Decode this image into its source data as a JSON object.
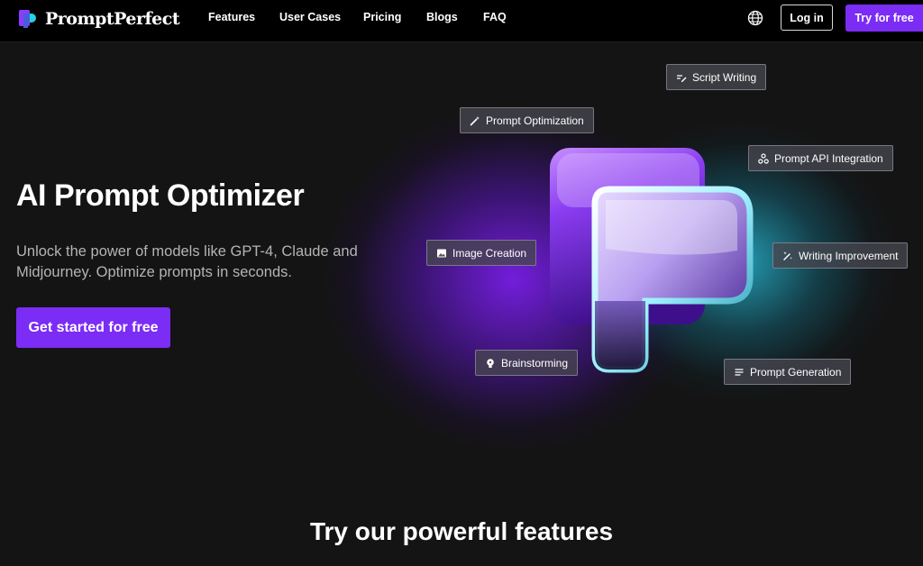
{
  "brand": {
    "name": "PromptPerfect"
  },
  "nav": {
    "links": [
      "Features",
      "User Cases",
      "Pricing",
      "Blogs",
      "FAQ"
    ],
    "login_label": "Log in",
    "try_label": "Try for free"
  },
  "hero": {
    "title": "AI Prompt Optimizer",
    "subtitle": "Unlock the power of models like GPT-4, Claude and Midjourney. Optimize prompts in seconds.",
    "cta_label": "Get started for free"
  },
  "chips": [
    {
      "label": "Script Writing",
      "icon": "pen-lines-icon"
    },
    {
      "label": "Prompt Optimization",
      "icon": "magic-wand-icon"
    },
    {
      "label": "Prompt API Integration",
      "icon": "api-nodes-icon"
    },
    {
      "label": "Image Creation",
      "icon": "image-icon"
    },
    {
      "label": "Writing Improvement",
      "icon": "sparkle-pen-icon"
    },
    {
      "label": "Brainstorming",
      "icon": "lightbulb-icon"
    },
    {
      "label": "Prompt Generation",
      "icon": "text-lines-icon"
    }
  ],
  "features_section": {
    "title": "Try our powerful features"
  },
  "colors": {
    "accent": "#7b2cf5",
    "background": "#141414",
    "nav_background": "#000000"
  }
}
